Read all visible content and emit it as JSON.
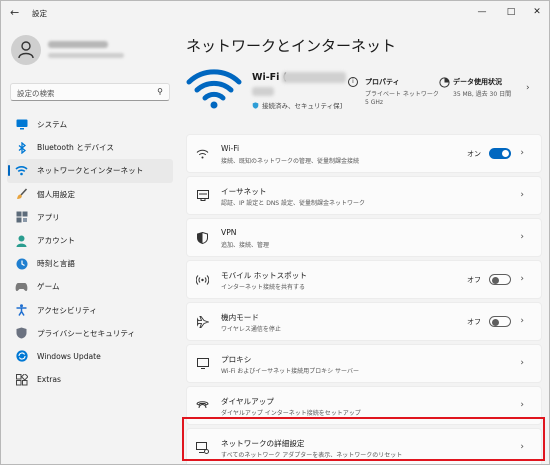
{
  "window": {
    "app_title": "設定",
    "back_icon": "back-arrow-icon",
    "controls": [
      "minimize-icon",
      "maximize-icon",
      "close-icon"
    ]
  },
  "sidebar": {
    "search_placeholder": "設定の検索",
    "items": [
      {
        "label": "システム",
        "icon": "system-icon",
        "color": "#0078d4"
      },
      {
        "label": "Bluetooth とデバイス",
        "icon": "bluetooth-icon",
        "color": "#0078d4"
      },
      {
        "label": "ネットワークとインターネット",
        "icon": "network-icon",
        "color": "#0078d4",
        "active": true
      },
      {
        "label": "個人用設定",
        "icon": "brush-icon",
        "color": "#e8a33d"
      },
      {
        "label": "アプリ",
        "icon": "apps-icon",
        "color": "#5c6b7a"
      },
      {
        "label": "アカウント",
        "icon": "account-icon",
        "color": "#2a9d8f"
      },
      {
        "label": "時刻と言語",
        "icon": "time-language-icon",
        "color": "#1f7fd0"
      },
      {
        "label": "ゲーム",
        "icon": "game-icon",
        "color": "#7a7a7a"
      },
      {
        "label": "アクセシビリティ",
        "icon": "accessibility-icon",
        "color": "#1f6fd0"
      },
      {
        "label": "プライバシーとセキュリティ",
        "icon": "shield-icon",
        "color": "#6b7280"
      },
      {
        "label": "Windows Update",
        "icon": "windows-update-icon",
        "color": "#0078d4"
      },
      {
        "label": "Extras",
        "icon": "extras-icon",
        "color": "#444444"
      }
    ]
  },
  "main": {
    "title": "ネットワークとインターネット",
    "connection": {
      "name": "Wi-Fi (",
      "status": "接続済み、セキュリティ保]"
    },
    "properties": {
      "title": "プロパティ",
      "line1": "プライベート ネットワーク",
      "line2": "5 GHz"
    },
    "data_usage": {
      "title": "データ使用状況",
      "line1": "35 MB, 過去 30 日間"
    },
    "rows": [
      {
        "title": "Wi-Fi",
        "desc": "接続、既知のネットワークの管理、従量制課金接続",
        "icon": "wifi-icon",
        "toggle_label": "オン",
        "toggle": "on"
      },
      {
        "title": "イーサネット",
        "desc": "認証、IP 設定と DNS 設定、従量制課金ネットワーク",
        "icon": "ethernet-icon"
      },
      {
        "title": "VPN",
        "desc": "追加、接続、管理",
        "icon": "vpn-shield-icon"
      },
      {
        "title": "モバイル ホットスポット",
        "desc": "インターネット接続を共有する",
        "icon": "hotspot-icon",
        "toggle_label": "オフ",
        "toggle": "off"
      },
      {
        "title": "機内モード",
        "desc": "ワイヤレス通信を停止",
        "icon": "airplane-icon",
        "toggle_label": "オフ",
        "toggle": "off"
      },
      {
        "title": "プロキシ",
        "desc": "Wi-Fi およびイーサネット接続用プロキシ サーバー",
        "icon": "proxy-icon"
      },
      {
        "title": "ダイヤルアップ",
        "desc": "ダイヤルアップ インターネット接続をセットアップ",
        "icon": "dialup-icon"
      },
      {
        "title": "ネットワークの詳細設定",
        "desc": "すべてのネットワーク アダプターを表示、ネットワークのリセット",
        "icon": "advanced-network-icon"
      }
    ]
  },
  "accent_color": "#0067c0",
  "highlight_color": "#e0151e"
}
